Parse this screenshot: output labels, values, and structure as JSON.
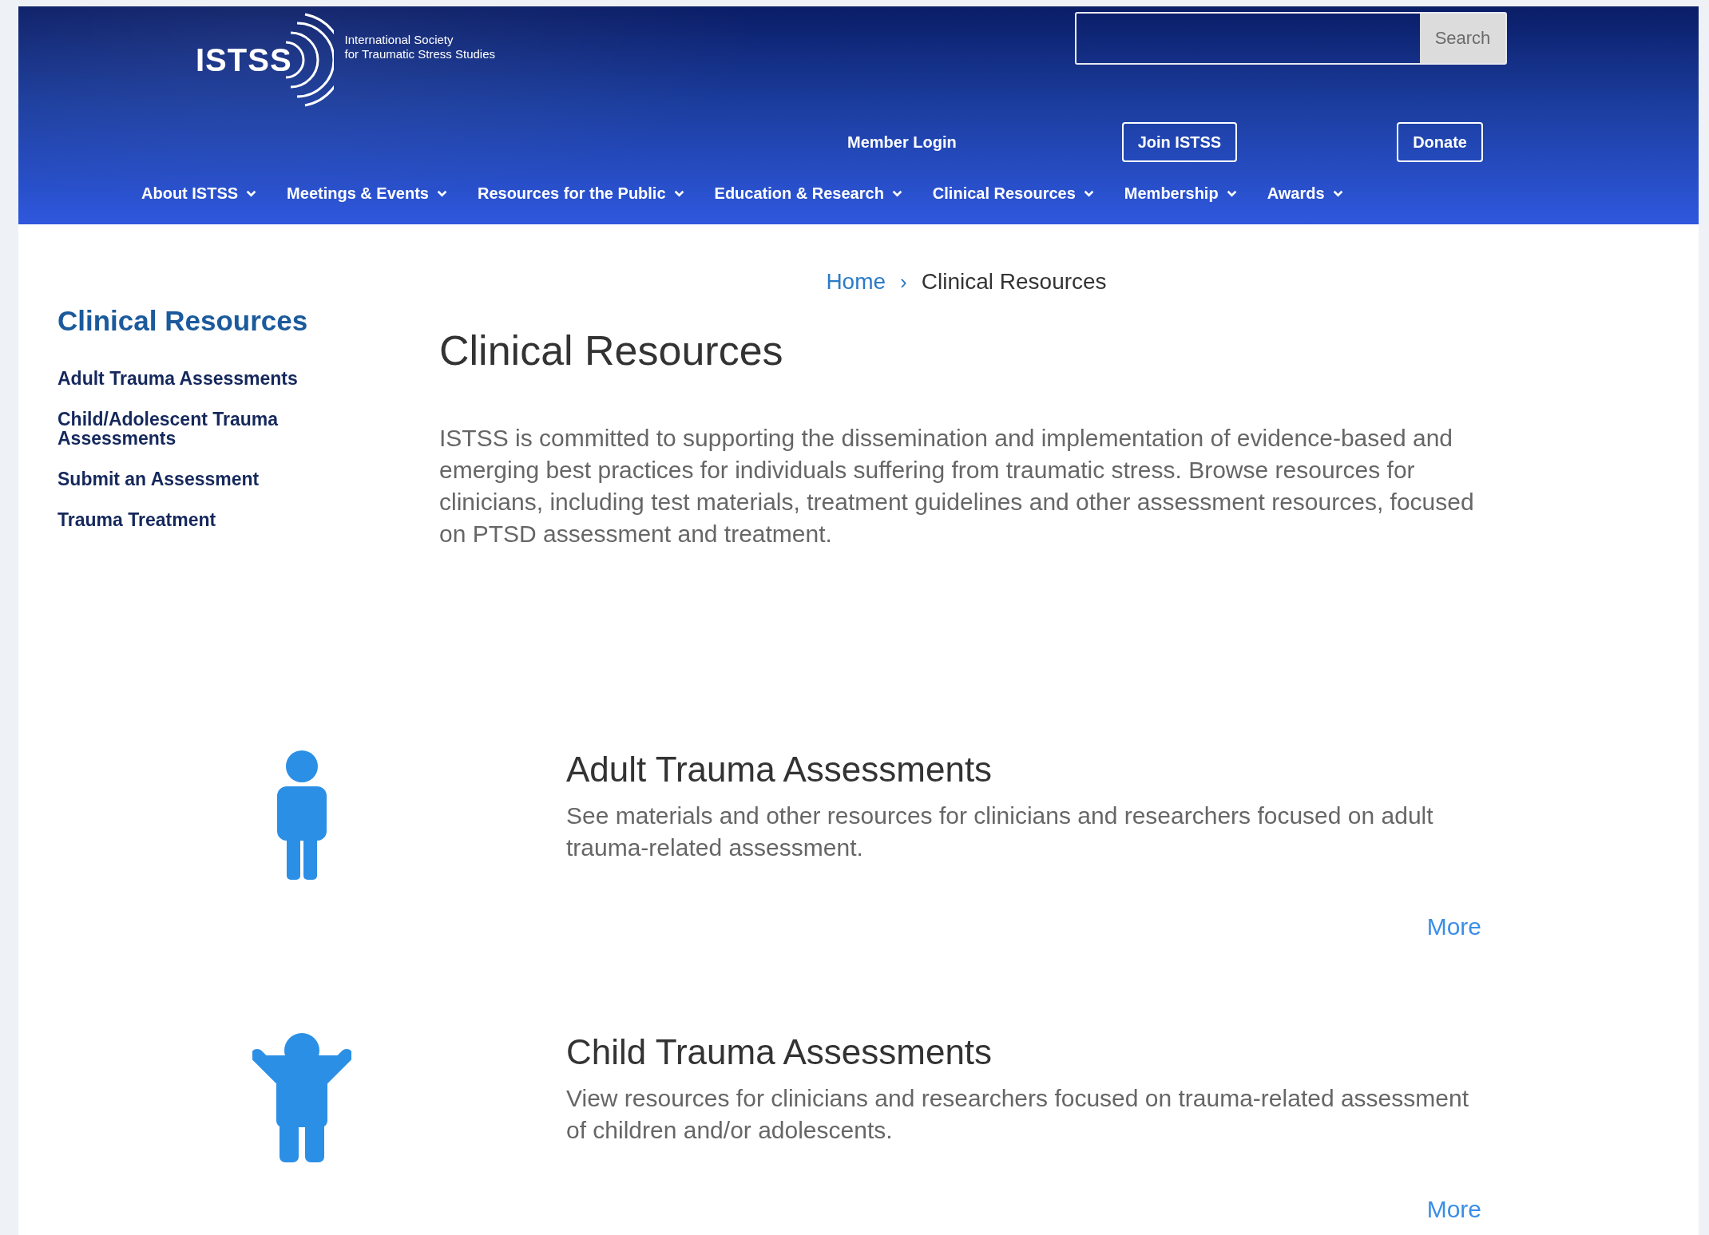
{
  "header": {
    "logo": {
      "mark": "ISTSS",
      "name_line_1": "International Society",
      "name_line_2": "for Traumatic Stress Studies"
    },
    "search": {
      "button": "Search"
    },
    "member_login": "Member Login",
    "buttons": [
      "Join ISTSS",
      "Donate"
    ],
    "nav": [
      {
        "label": "About ISTSS"
      },
      {
        "label": "Meetings & Events"
      },
      {
        "label": "Resources for the Public"
      },
      {
        "label": "Education & Research"
      },
      {
        "label": "Clinical Resources"
      },
      {
        "label": "Membership"
      },
      {
        "label": "Awards"
      }
    ]
  },
  "breadcrumb": {
    "items": [
      "Home",
      "Clinical Resources"
    ],
    "separator": "›"
  },
  "sidebar": {
    "title": "Clinical Resources",
    "items": [
      "Adult Trauma Assessments",
      "Child/Adolescent Trauma Assessments",
      "Submit an Assessment",
      "Trauma Treatment"
    ]
  },
  "main": {
    "title": "Clinical Resources",
    "intro": "ISTSS is committed to supporting the dissemination and implementation of evidence-based and emerging best practices for individuals suffering from traumatic stress. Browse resources for clinicians, including test materials, treatment guidelines and other assessment resources, focused on PTSD assessment and treatment."
  },
  "cards": [
    {
      "kind": "adult",
      "title": "Adult Trauma Assessments",
      "description": "See materials and other resources for clinicians and researchers focused on adult trauma-related assessment.",
      "link": "More"
    },
    {
      "kind": "child",
      "title": "Child Trauma Assessments",
      "description": "View resources for clinicians and researchers focused on trauma-related assessment of children and/or adolescents.",
      "link": "More"
    }
  ]
}
